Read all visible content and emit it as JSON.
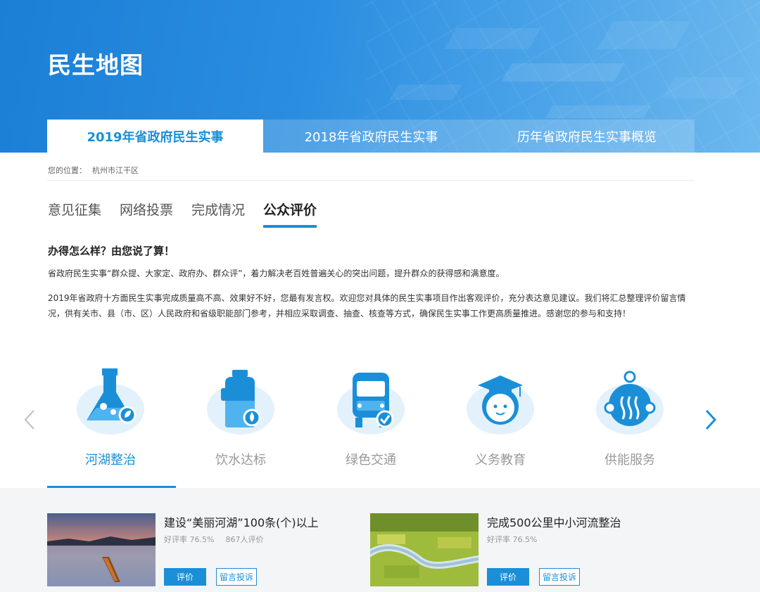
{
  "banner": {
    "title": "民生地图"
  },
  "top_tabs": [
    {
      "label": "2019年省政府民生实事",
      "active": true
    },
    {
      "label": "2018年省政府民生实事",
      "active": false
    },
    {
      "label": "历年省政府民生实事概览",
      "active": false
    }
  ],
  "breadcrumb": {
    "prefix": "您的位置：",
    "location": "杭州市江干区"
  },
  "sub_tabs": [
    {
      "label": "意见征集",
      "active": false
    },
    {
      "label": "网络投票",
      "active": false
    },
    {
      "label": "完成情况",
      "active": false
    },
    {
      "label": "公众评价",
      "active": true
    }
  ],
  "content": {
    "headline": "办得怎么样？由您说了算！",
    "para1": "省政府民生实事“群众提、大家定、政府办、群众评”，着力解决老百姓普遍关心的突出问题，提升群众的获得感和满意度。",
    "para2": "2019年省政府十方面民生实事完成质量高不高、效果好不好，您最有发言权。欢迎您对具体的民生实事项目作出客观评价，充分表达意见建议。我们将汇总整理评价留言情况，供有关市、县（市、区）人民政府和省级职能部门参考，并相应采取调查、抽查、核查等方式，确保民生实事工作更高质量推进。感谢您的参与和支持！"
  },
  "categories": [
    {
      "label": "河湖整治",
      "icon": "flask-icon",
      "active": true
    },
    {
      "label": "饮水达标",
      "icon": "water-bottle-icon",
      "active": false
    },
    {
      "label": "绿色交通",
      "icon": "bus-icon",
      "active": false
    },
    {
      "label": "义务教育",
      "icon": "graduate-icon",
      "active": false
    },
    {
      "label": "供能服务",
      "icon": "energy-icon",
      "active": false
    }
  ],
  "items": [
    {
      "title": "建设“美丽河湖”100条(个)以上",
      "rating": "好评率 76.5%",
      "count": "867人评价",
      "btn_rate": "评价",
      "btn_comment": "留言投诉"
    },
    {
      "title": "完成500公里中小河流整治",
      "rating": "好评率 76.5%",
      "btn_rate": "评价",
      "btn_comment": "留言投诉"
    }
  ],
  "colors": {
    "accent": "#1a8fd8",
    "banner": "#2a8de0",
    "icon_bg": "#e3f1fc"
  }
}
